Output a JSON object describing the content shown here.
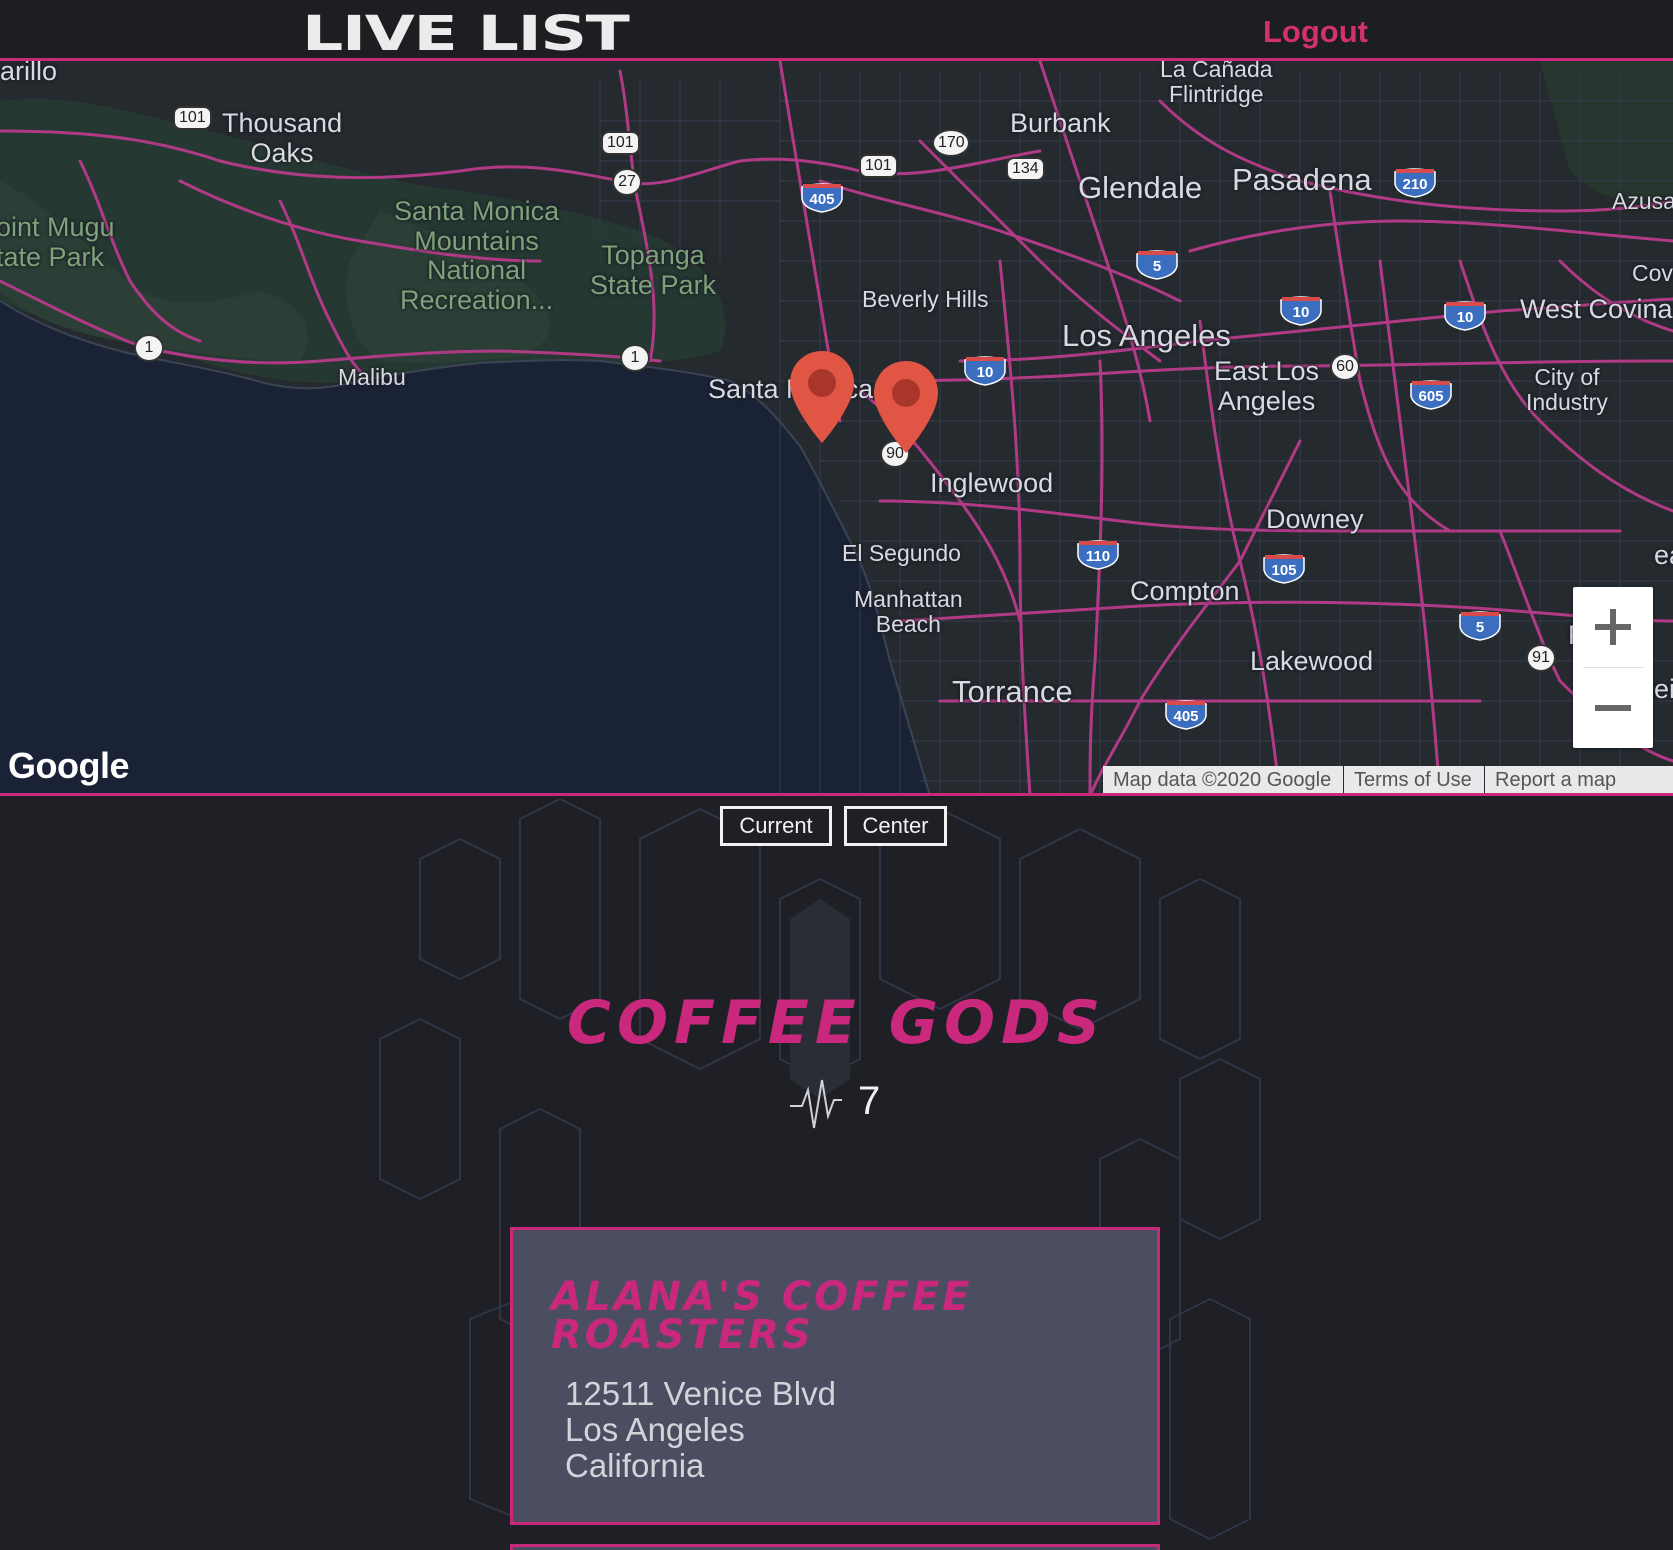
{
  "header": {
    "logo": "LIVE LIST",
    "logout": "Logout"
  },
  "map": {
    "places": [
      {
        "key": "camarillo",
        "text": "arillo"
      },
      {
        "key": "thousand_oaks",
        "text": "Thousand\nOaks"
      },
      {
        "key": "point_mugu",
        "text": "oint Mugu\ntate Park"
      },
      {
        "key": "santa_monica_mtns",
        "text": "Santa Monica\nMountains\nNational\nRecreation..."
      },
      {
        "key": "topanga",
        "text": "Topanga\nState Park"
      },
      {
        "key": "malibu",
        "text": "Malibu"
      },
      {
        "key": "la_canada",
        "text": "La Cañada\nFlintridge"
      },
      {
        "key": "burbank",
        "text": "Burbank"
      },
      {
        "key": "glendale",
        "text": "Glendale"
      },
      {
        "key": "pasadena",
        "text": "Pasadena"
      },
      {
        "key": "azusa",
        "text": "Azusa"
      },
      {
        "key": "covina",
        "text": "Cov"
      },
      {
        "key": "west_covina",
        "text": "West Covina"
      },
      {
        "key": "beverly_hills",
        "text": "Beverly Hills"
      },
      {
        "key": "los_angeles",
        "text": "Los Angeles"
      },
      {
        "key": "east_la",
        "text": "East Los\nAngeles"
      },
      {
        "key": "city_industry",
        "text": "City of\nIndustry"
      },
      {
        "key": "santa_monica",
        "text": "Santa Monica"
      },
      {
        "key": "inglewood",
        "text": "Inglewood"
      },
      {
        "key": "downey",
        "text": "Downey"
      },
      {
        "key": "el_segundo",
        "text": "El Segundo"
      },
      {
        "key": "manhattan_beach",
        "text": "Manhattan\nBeach"
      },
      {
        "key": "compton",
        "text": "Compton"
      },
      {
        "key": "lakewood",
        "text": "Lakewood"
      },
      {
        "key": "torrance",
        "text": "Torrance"
      },
      {
        "key": "fullerton_partial",
        "text": "F"
      },
      {
        "key": "east_partial",
        "text": "ea"
      },
      {
        "key": "anaheim_partial",
        "text": "ei"
      }
    ],
    "shields": [
      "101",
      "101",
      "27",
      "101",
      "170",
      "134",
      "1",
      "1",
      "90",
      "60",
      "91"
    ],
    "interstates": [
      "405",
      "210",
      "5",
      "10",
      "10",
      "10",
      "605",
      "110",
      "105",
      "5",
      "405"
    ],
    "google": "Google",
    "attribution": {
      "map_data": "Map data ©2020 Google",
      "terms": "Terms of Use",
      "report": "Report a map error"
    },
    "zoom_in": "+",
    "zoom_out": "−",
    "markers": 2
  },
  "controls": {
    "current": "Current",
    "center": "Center"
  },
  "list": {
    "title": "COFFEE GODS",
    "pulse_count": "7",
    "colors": {
      "accent": "#c9287d",
      "card_bg": "#4b4e60",
      "page_bg": "#1f2026"
    }
  },
  "cards": [
    {
      "name": "ALANA'S COFFEE ROASTERS",
      "street": "12511 Venice Blvd",
      "city": "Los Angeles",
      "state": "California"
    }
  ]
}
